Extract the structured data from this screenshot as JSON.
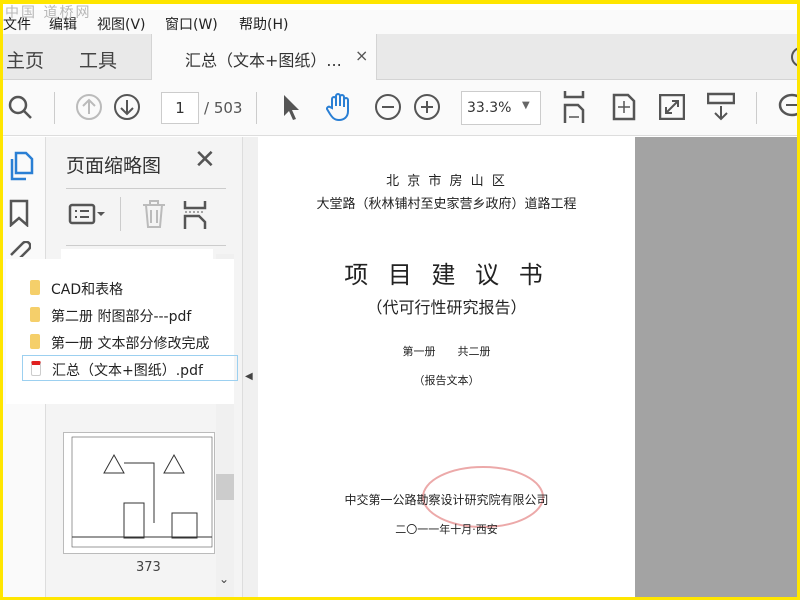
{
  "watermark": "中国 道桥网",
  "menu": [
    "文件",
    "编辑",
    "视图(V)",
    "窗口(W)",
    "帮助(H)"
  ],
  "tabs": {
    "home": "主页",
    "tools": "工具",
    "document": "汇总（文本+图纸）...",
    "close": "×"
  },
  "toolbar": {
    "page_current": "1",
    "page_total": "/ 503",
    "zoom": "33.3%"
  },
  "panel": {
    "title": "页面缩略图",
    "thumb_page": "373"
  },
  "files": [
    {
      "name": "CAD和表格",
      "type": "folder"
    },
    {
      "name": "第二册 附图部分---pdf",
      "type": "folder"
    },
    {
      "name": "第一册  文本部分修改完成",
      "type": "folder"
    },
    {
      "name": "汇总（文本+图纸）.pdf",
      "type": "pdf",
      "selected": true
    }
  ],
  "document": {
    "line1": "北 京 市 房 山 区",
    "line2": "大堂路（秋林铺村至史家营乡政府）道路工程",
    "title": "项 目 建 议 书",
    "subtitle": "（代可行性研究报告）",
    "volume": "第一册　　共二册",
    "part": "（报告文本）",
    "org": "中交第一公路勘察设计研究院有限公司",
    "date": "二〇一一年十月·西安"
  },
  "colors": {
    "accent": "#2a7fd4",
    "border": "#ffe600"
  }
}
